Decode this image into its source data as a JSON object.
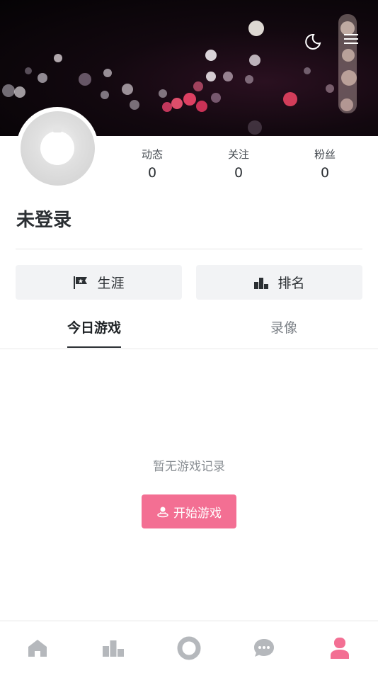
{
  "header": {
    "theme_icon": "moon-icon",
    "menu_icon": "menu-icon"
  },
  "profile": {
    "avatar_icon": "default-avatar",
    "username": "未登录"
  },
  "stats": [
    {
      "label": "动态",
      "value": "0"
    },
    {
      "label": "关注",
      "value": "0"
    },
    {
      "label": "粉丝",
      "value": "0"
    }
  ],
  "actions": {
    "career_label": "生涯",
    "career_icon": "flag-icon",
    "rank_label": "排名",
    "rank_icon": "podium-icon"
  },
  "tabs": [
    {
      "label": "今日游戏",
      "active": true
    },
    {
      "label": "录像",
      "active": false
    }
  ],
  "empty_state": {
    "text": "暂无游戏记录",
    "button_label": "开始游戏",
    "button_icon": "user-pin-icon"
  },
  "bottom_nav": [
    {
      "icon": "home-icon",
      "active": false
    },
    {
      "icon": "leaderboard-icon",
      "active": false
    },
    {
      "icon": "circle-icon",
      "active": false
    },
    {
      "icon": "chat-icon",
      "active": false
    },
    {
      "icon": "profile-icon",
      "active": true
    }
  ],
  "colors": {
    "accent": "#f36f93",
    "nav_inactive": "#b5b8bc",
    "text_primary": "#2b2f33",
    "text_muted": "#8a8f94"
  }
}
